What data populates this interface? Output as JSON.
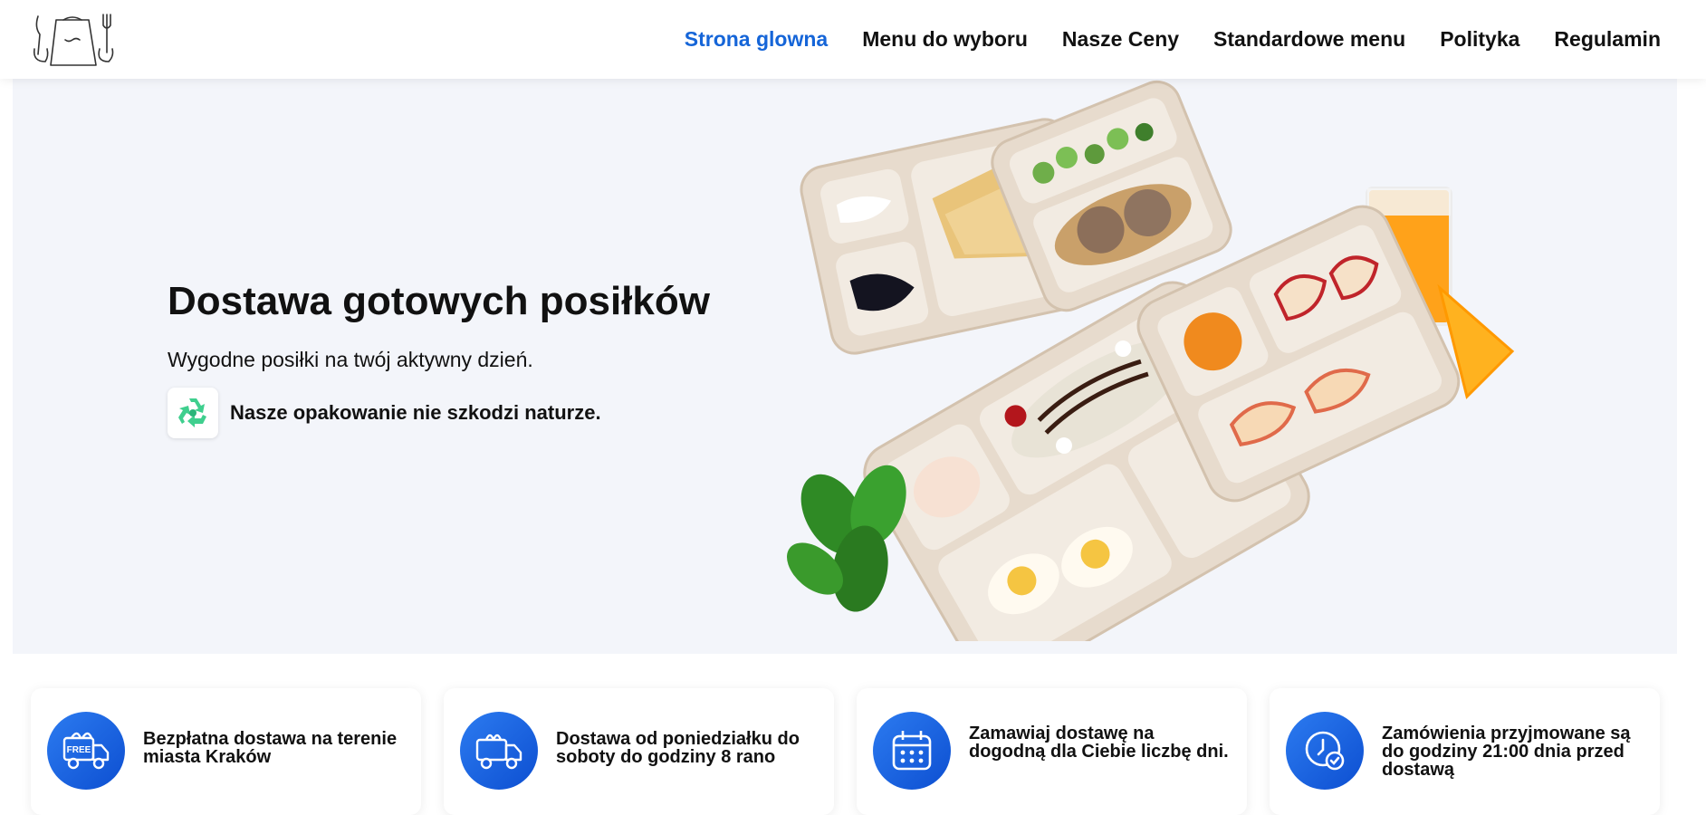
{
  "nav": {
    "items": [
      {
        "label": "Strona glowna",
        "active": true
      },
      {
        "label": "Menu do wyboru",
        "active": false
      },
      {
        "label": "Nasze Ceny",
        "active": false
      },
      {
        "label": "Standardowe menu",
        "active": false
      },
      {
        "label": "Polityka",
        "active": false
      },
      {
        "label": "Regulamin",
        "active": false
      }
    ]
  },
  "hero": {
    "title": "Dostawa gotowych posiłków",
    "subtitle": "Wygodne posiłki na twój aktywny dzień.",
    "eco_text": "Nasze opakowanie nie szkodzi naturze.",
    "eco_icon": "recycle-icon"
  },
  "features": [
    {
      "icon": "free-delivery-truck-icon",
      "text": "Bezpłatna dostawa na terenie miasta Kraków",
      "badge": "FREE"
    },
    {
      "icon": "gift-delivery-truck-icon",
      "text": "Dostawa od poniedziałku do soboty do godziny 8 rano"
    },
    {
      "icon": "calendar-icon",
      "text": "Zamawiaj dostawę na dogodną dla Ciebie liczbę dni."
    },
    {
      "icon": "clock-check-icon",
      "text": "Zamówienia przyjmowane są do godziny 21:00 dnia przed dostawą"
    }
  ],
  "colors": {
    "accent": "#1565d8",
    "hero_bg": "#f3f5fa",
    "icon_circle": "#1a5fe0",
    "eco_green": "#3fcf8e"
  }
}
